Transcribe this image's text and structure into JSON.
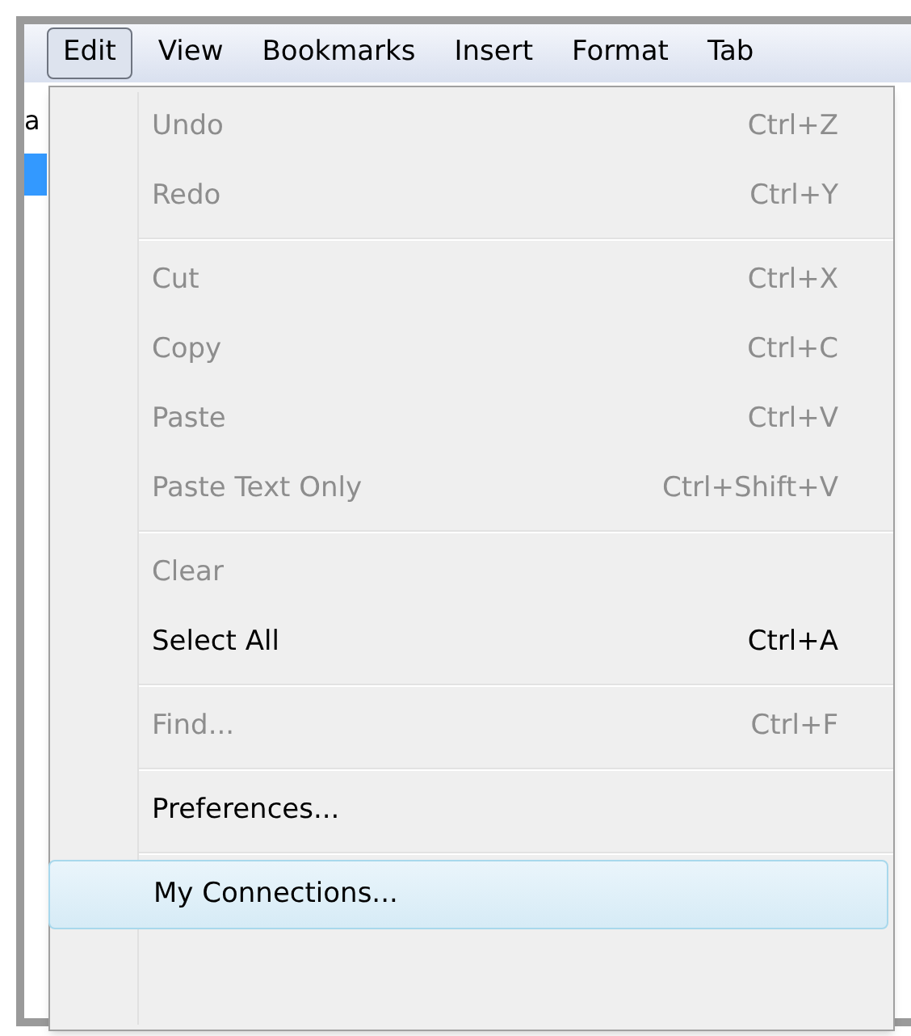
{
  "menu_bar": [
    {
      "label": "Edit",
      "selected": true
    },
    {
      "label": "View",
      "selected": false
    },
    {
      "label": "Bookmarks",
      "selected": false
    },
    {
      "label": "Insert",
      "selected": false
    },
    {
      "label": "Format",
      "selected": false
    },
    {
      "label": "Tab",
      "selected": false
    }
  ],
  "background": {
    "cell_text": "a"
  },
  "menu": [
    {
      "kind": "item",
      "label": "Undo",
      "shortcut": "Ctrl+Z",
      "disabled": true,
      "selected": false
    },
    {
      "kind": "item",
      "label": "Redo",
      "shortcut": "Ctrl+Y",
      "disabled": true,
      "selected": false
    },
    {
      "kind": "separator"
    },
    {
      "kind": "item",
      "label": "Cut",
      "shortcut": "Ctrl+X",
      "disabled": true,
      "selected": false
    },
    {
      "kind": "item",
      "label": "Copy",
      "shortcut": "Ctrl+C",
      "disabled": true,
      "selected": false
    },
    {
      "kind": "item",
      "label": "Paste",
      "shortcut": "Ctrl+V",
      "disabled": true,
      "selected": false
    },
    {
      "kind": "item",
      "label": "Paste Text Only",
      "shortcut": "Ctrl+Shift+V",
      "disabled": true,
      "selected": false
    },
    {
      "kind": "separator"
    },
    {
      "kind": "item",
      "label": "Clear",
      "disabled": true,
      "selected": false
    },
    {
      "kind": "item",
      "label": "Select All",
      "shortcut": "Ctrl+A",
      "disabled": false,
      "selected": false
    },
    {
      "kind": "separator"
    },
    {
      "kind": "item",
      "label": "Find...",
      "shortcut": "Ctrl+F",
      "disabled": true,
      "selected": false
    },
    {
      "kind": "separator"
    },
    {
      "kind": "item",
      "label": "Preferences...",
      "disabled": false,
      "selected": false
    },
    {
      "kind": "separator"
    },
    {
      "kind": "item",
      "label": "My Connections...",
      "disabled": false,
      "selected": true
    }
  ]
}
